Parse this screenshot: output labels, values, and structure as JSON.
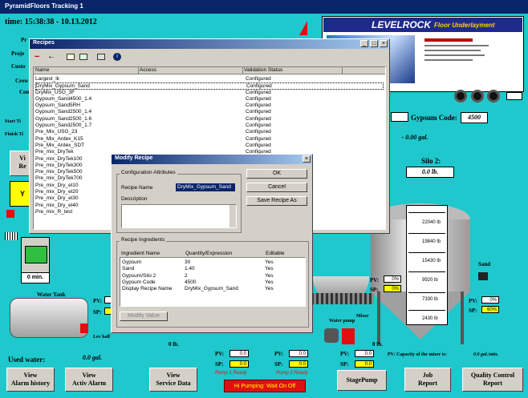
{
  "app": {
    "title": "PyramidFloors Tracking 1"
  },
  "header": {
    "time": "time: 15:38:38 - 10.13.2012",
    "partial_labels": [
      "Pr",
      "Proje",
      "Custo",
      "Crew",
      "Com"
    ]
  },
  "ad": {
    "brand": "LEVELROCK",
    "tagline": "Floor Underlayment"
  },
  "gypsum": {
    "label": "Gypsum Code:",
    "value": "4500"
  },
  "gal_display": "- 0.00 gal.",
  "silo2": {
    "label": "Silo 2:",
    "value": "0.0 lb."
  },
  "silo_scale": [
    "22040 lb",
    "19840 lb",
    "15430 lb",
    "9920 lb",
    "7330 lb",
    "2430 lb"
  ],
  "recipes_window": {
    "title": "Recipes",
    "columns": [
      "Name",
      "Access",
      "Validation Status"
    ],
    "rows": [
      {
        "name": "Largest_lk",
        "status": "Configured"
      },
      {
        "name": "DryMix_Gypsum_Sand",
        "status": "Configured"
      },
      {
        "name": "DryMix_USG_3F",
        "status": "Configured"
      },
      {
        "name": "Gypsum_Sand4500_1.4",
        "status": "Configured"
      },
      {
        "name": "Gypsum_Sand5RH",
        "status": "Configured"
      },
      {
        "name": "Gypsum_Sand2500_1.4",
        "status": "Configured"
      },
      {
        "name": "Gypsum_Sand2500_1.6",
        "status": "Configured"
      },
      {
        "name": "Gypsum_Sand2500_1.7",
        "status": "Configured"
      },
      {
        "name": "Pre_Mix_USG_23",
        "status": "Configured"
      },
      {
        "name": "Pre_Mix_Ardex_K15",
        "status": "Configured"
      },
      {
        "name": "Pre_Mix_Ardex_SDT",
        "status": "Configured"
      },
      {
        "name": "Pre_mix_DryTek",
        "status": "Configured"
      },
      {
        "name": "Pre_mix_DryTek100",
        "status": "Configured"
      },
      {
        "name": "Pre_mix_DryTek300",
        "status": "Configured"
      },
      {
        "name": "Pre_mix_DryTek500",
        "status": "Configured"
      },
      {
        "name": "Pre_mix_DryTek700",
        "status": "Configured"
      },
      {
        "name": "Pre_mix_Dry_el10",
        "status": "Configured"
      },
      {
        "name": "Pre_mix_Dry_el20",
        "status": "Configured"
      },
      {
        "name": "Pre_mix_Dry_el30",
        "status": "Configured"
      },
      {
        "name": "Pre_mix_Dry_el40",
        "status": "Configured"
      },
      {
        "name": "Pre_mix_R_test",
        "status": "Configured"
      }
    ]
  },
  "modify_dialog": {
    "title": "Modify Recipe",
    "config_group": "Configuration Attributes",
    "recipe_name_label": "Recipe Name",
    "recipe_name_value": "DryMix_Gypsum_Sand",
    "description_label": "Description",
    "ok": "OK",
    "cancel": "Cancel",
    "save_as": "Save Recipe As",
    "ingredients_group": "Recipe Ingredients",
    "ing_columns": [
      "Ingredient Name",
      "Quantity/Expression",
      "Editable"
    ],
    "ingredients": [
      {
        "name": "Gypsum",
        "qty": "30",
        "edit": "Yes"
      },
      {
        "name": "Sand",
        "qty": "1.40",
        "edit": "Yes"
      },
      {
        "name": "Gypsum/Silo 2",
        "qty": "2",
        "edit": "Yes"
      },
      {
        "name": "Gypsum Code",
        "qty": "4500",
        "edit": "Yes"
      },
      {
        "name": "Display Recipe Name",
        "qty": "DryMix_Gypsum_Sand",
        "edit": "Yes"
      }
    ],
    "modify_value": "Modify Value"
  },
  "left_panel": {
    "start": "Start Ti",
    "finish": "Finish Ti",
    "vi_btn": "Vi\nRe",
    "y_btn": "Y",
    "auto_btn": "0 min.",
    "water": "Water Tank",
    "lev_half": "Lev half",
    "used_water_label": "Used water:",
    "used_water_value": "0.0 gal."
  },
  "process": {
    "sand": "Sand",
    "mixer": "Mixer",
    "water_pump": "Water pump",
    "clock": "0 lb.",
    "clock2": "0 lb.",
    "pump1": "Pump 1 Ready",
    "pump2": "Pump 2 Ready",
    "pumping": "Hi Pumping: Wait On Off"
  },
  "gauges": [
    {
      "pv": "0%",
      "sp": "0%"
    },
    {
      "pv": "0%",
      "sp": "60%"
    },
    {
      "pv": "0.0",
      "sp": "0.0"
    },
    {
      "pv": "0.0",
      "sp": "0.0"
    },
    {
      "pv": "0.0",
      "sp": "0.0"
    },
    {
      "pv": "0.0",
      "sp": "0.0"
    }
  ],
  "capacity": {
    "label": "PV: Capacity of the mixer is:",
    "value": "0.0 gal./min."
  },
  "bottom_buttons": [
    {
      "label": "View\nAlarm history"
    },
    {
      "label": "View\nActiv Alarm"
    },
    {
      "label": "View\nService Data"
    },
    {
      "label": "StagePump"
    },
    {
      "label": "Job\nReport"
    },
    {
      "label": "Quality Control\nReport"
    }
  ],
  "colors": {
    "bg": "#1ec8cc",
    "title": "#0a246a",
    "red": "#e01010",
    "yellow": "#ffff00"
  }
}
